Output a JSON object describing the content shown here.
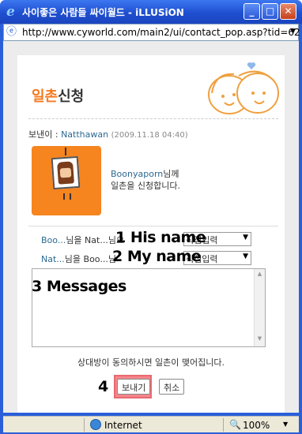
{
  "window": {
    "title": "사이좋은 사람들 싸이월드 - iLLUSiON",
    "minimize": "_",
    "maximize": "□",
    "close": "✕"
  },
  "address": {
    "url": "http://www.cyworld.com/main2/ui/contact_pop.asp?tid=62"
  },
  "popup": {
    "logo_part1": "일촌",
    "logo_part2": "신청",
    "sender_label": "보낸이 :",
    "sender_name": "Natthawan",
    "sender_date": "(2009.11.18 04:40)",
    "recipient_name": "Boonyaporn",
    "recipient_suffix": "님께",
    "request_text": "일촌을 신청합니다.",
    "row1_a": "Boo...",
    "row1_mid": "님을 Nat...",
    "row1_b": "님으",
    "row1_select": "직접입력",
    "row2_a": "Nat...",
    "row2_mid": "님을 Boo...",
    "row2_b": "님",
    "row2_select": "직접입력",
    "notice": "상대방이 동의하시면 일촌이 맺어집니다.",
    "send_label": "보내기",
    "cancel_label": "취소"
  },
  "annotations": {
    "a1": "1 His name",
    "a2": "2 My name",
    "a3": "3 Messages",
    "a4": "4"
  },
  "status": {
    "zone": "Internet",
    "zoom": "100%"
  },
  "colors": {
    "accent_orange": "#f6841f",
    "link_blue": "#2b6a93",
    "highlight_red": "#f5868b"
  }
}
